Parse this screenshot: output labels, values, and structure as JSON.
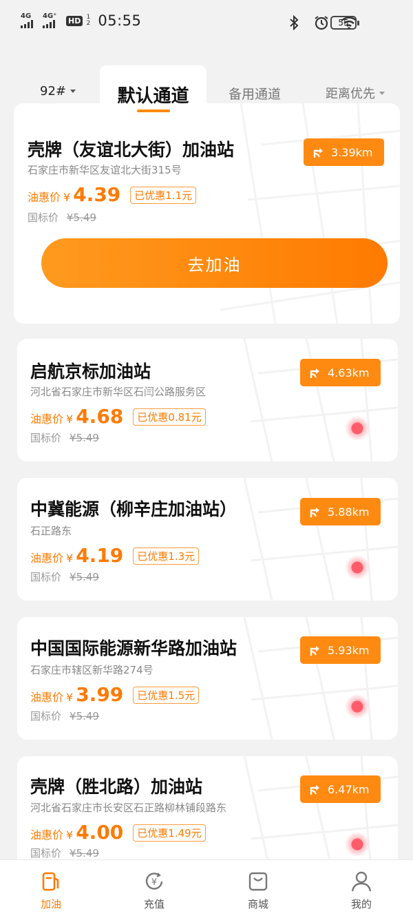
{
  "status_bar": {
    "network_1": "4G",
    "network_2": "4G⁺",
    "hd_badge": "HD",
    "hd_sub": "1 2",
    "time": "05:55",
    "battery": "55",
    "icons": [
      "bluetooth-icon",
      "alarm-icon",
      "wifi-icon"
    ]
  },
  "tabs": {
    "fuel_type": "92#",
    "active_tab": "默认通道",
    "backup_tab": "备用通道",
    "sort": "距离优先"
  },
  "labels": {
    "price_label": "油惠价",
    "currency": "¥",
    "std_label": "国标价",
    "go_button": "去加油"
  },
  "stations": [
    {
      "name": "壳牌（友谊北大街）加油站",
      "address": "石家庄市新华区友谊北大街315号",
      "price": "4.39",
      "discount": "已优惠1.1元",
      "std_price": "¥5.49",
      "distance": "3.39km"
    },
    {
      "name": "启航京标加油站",
      "address": "河北省石家庄市新华区石闫公路服务区",
      "price": "4.68",
      "discount": "已优惠0.81元",
      "std_price": "¥5.49",
      "distance": "4.63km"
    },
    {
      "name": "中冀能源（柳辛庄加油站）",
      "address": "石正路东",
      "price": "4.19",
      "discount": "已优惠1.3元",
      "std_price": "¥5.49",
      "distance": "5.88km"
    },
    {
      "name": "中国国际能源新华路加油站",
      "address": "石家庄市辖区新华路274号",
      "price": "3.99",
      "discount": "已优惠1.5元",
      "std_price": "¥5.49",
      "distance": "5.93km"
    },
    {
      "name": "壳牌（胜北路）加油站",
      "address": "河北省石家庄市长安区石正路柳林铺段路东",
      "price": "4.00",
      "discount": "已优惠1.49元",
      "std_price": "¥5.49",
      "distance": "6.47km"
    }
  ],
  "bottom_nav": [
    {
      "label": "加油",
      "icon": "fuel-pump-icon",
      "active": true
    },
    {
      "label": "充值",
      "icon": "recharge-icon",
      "active": false
    },
    {
      "label": "商城",
      "icon": "shop-bag-icon",
      "active": false
    },
    {
      "label": "我的",
      "icon": "user-icon",
      "active": false
    }
  ],
  "colors": {
    "accent": "#ff8a12",
    "price": "#ff7a00",
    "background": "#f2f2f3"
  }
}
